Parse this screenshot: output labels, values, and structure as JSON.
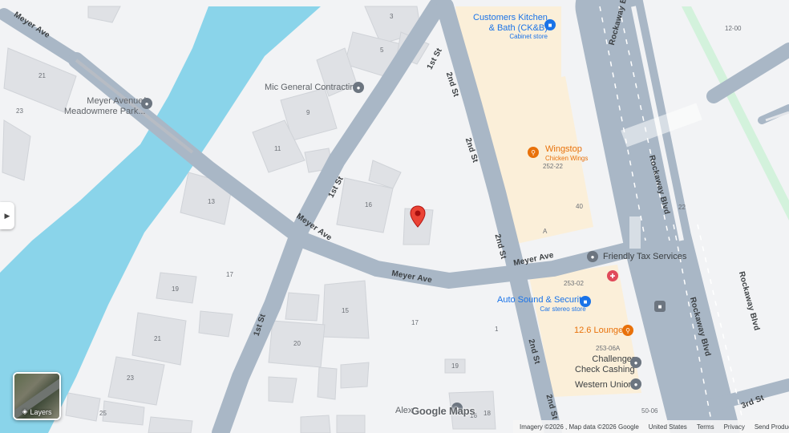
{
  "streets": {
    "meyer_ave_nw": "Meyer Ave",
    "meyer_ave_mid": "Meyer Ave",
    "meyer_ave_low": "Meyer Ave",
    "meyer_ave_east": "Meyer Ave",
    "first_st_top": "1st St",
    "first_st_mid": "1st St",
    "first_st_low": "1st St",
    "second_st_top": "2nd St",
    "second_st_mid": "2nd St",
    "second_st_mid2": "2nd St",
    "second_st_low": "2nd St",
    "second_st_bottom": "2nd St",
    "rockaway_blvd_top": "Rockaway Blvd",
    "rockaway_blvd_mid": "Rockaway Blvd",
    "rockaway_blvd_right": "Rockaway Blvd",
    "rockaway_blvd_low": "Rockaway Blvd",
    "third_st": "3rd St"
  },
  "pois": {
    "customers_kitchen_name": "Customers Kitchen",
    "customers_kitchen_name2": "& Bath (CK&B)",
    "customers_kitchen_cat": "Cabinet store",
    "mic_general": "Mic General Contracting",
    "meyer_station_name": "Meyer Avenue/",
    "meyer_station_name2": "Meadowmere Park...",
    "wingstop_name": "Wingstop",
    "wingstop_cat": "Chicken Wings",
    "friendly_tax": "Friendly Tax Services",
    "auto_sound_name": "Auto Sound & Security",
    "auto_sound_cat": "Car stereo store",
    "lounge": "12.6 Lounge",
    "challenger": "Challenger",
    "challenger2": "Check Cashing",
    "western_union": "Western Union",
    "alex": "Alex"
  },
  "house_numbers": [
    "3",
    "5",
    "21",
    "23",
    "9",
    "11",
    "13",
    "16",
    "17",
    "19",
    "21",
    "23",
    "25",
    "15",
    "20",
    "17",
    "1",
    "19",
    "18",
    "16",
    "252-22",
    "40",
    "A",
    "253-02",
    "253-06A",
    "12-00",
    "22",
    "50-06"
  ],
  "controls": {
    "layers_label": "Layers",
    "side_toggle_icon": "chevron-right-icon"
  },
  "footer": {
    "imagery": "Imagery ©2026 , Map data ©2026 Google",
    "country": "United States",
    "terms": "Terms",
    "privacy": "Privacy",
    "feedback": "Send Product Feedback",
    "logo": "Google Maps"
  },
  "colors": {
    "water": "#8ad4ea",
    "road": "#a9b7c6",
    "land": "#f2f3f5",
    "building": "#dfe1e5",
    "commercial": "#fbefd9",
    "park": "#d3f2dc",
    "accent_blue": "#1a73e8",
    "accent_orange": "#e8710a",
    "marker_red": "#ea4335"
  }
}
